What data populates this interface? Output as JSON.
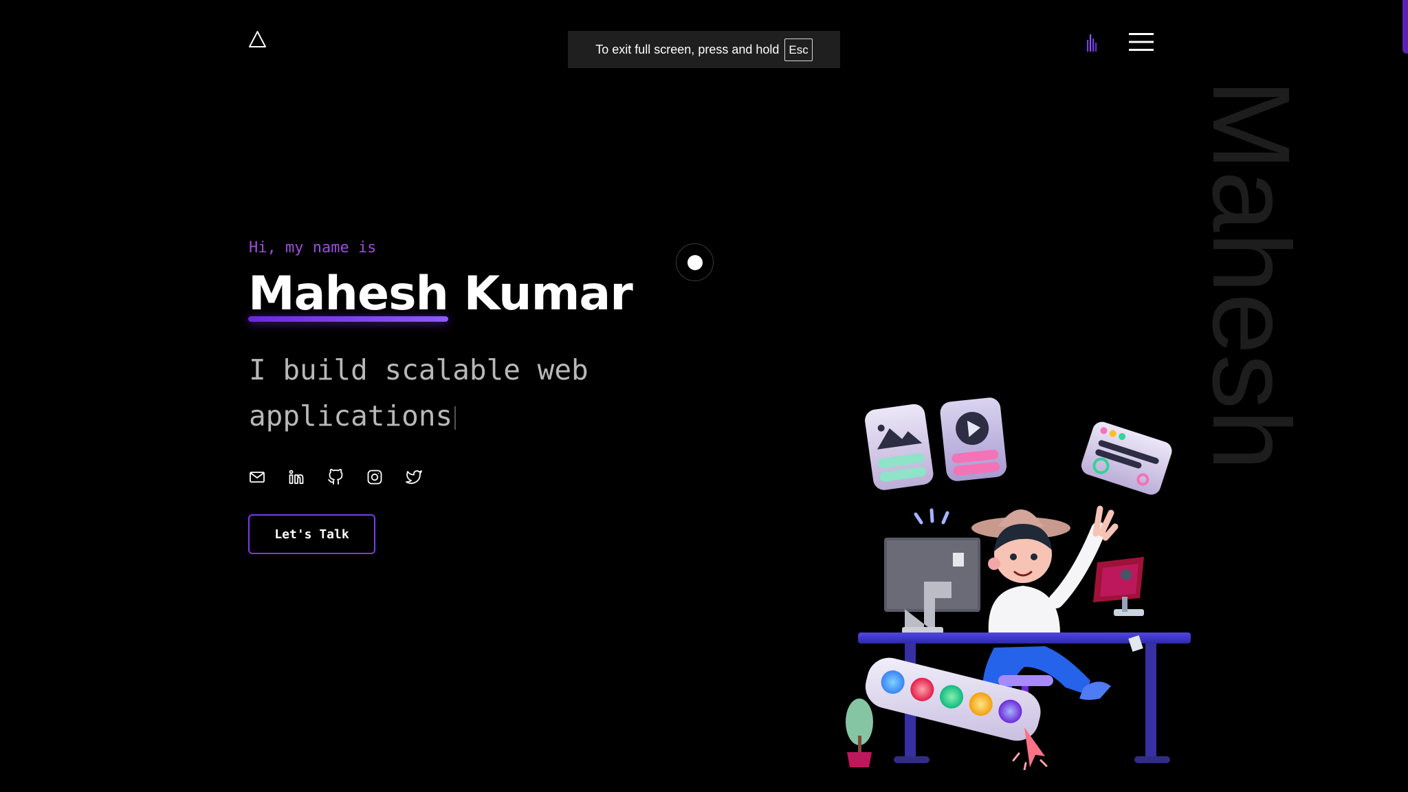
{
  "header": {
    "logo_icon": "triangle-logo-icon",
    "sound_icon": "sound-bars-icon",
    "menu_icon": "hamburger-menu-icon"
  },
  "fullscreen_notice": {
    "text": "To exit full screen, press and hold",
    "key": "Esc"
  },
  "hero": {
    "greeting": "Hi, my name is",
    "first_name": "Mahesh",
    "last_name": "Kumar",
    "tagline": "I build scalable web applications",
    "vertical_name": "Mahesh",
    "cta_label": "Let's Talk"
  },
  "socials": [
    {
      "name": "mail",
      "icon": "mail-icon"
    },
    {
      "name": "linkedin",
      "icon": "linkedin-icon"
    },
    {
      "name": "github",
      "icon": "github-icon"
    },
    {
      "name": "instagram",
      "icon": "instagram-icon"
    },
    {
      "name": "twitter",
      "icon": "twitter-icon"
    }
  ],
  "colors": {
    "background": "#000000",
    "accent": "#7c3aed",
    "greeting": "#9d4edd",
    "tagline": "#b8b8b8",
    "vertical_name": "#1d1d1d"
  }
}
